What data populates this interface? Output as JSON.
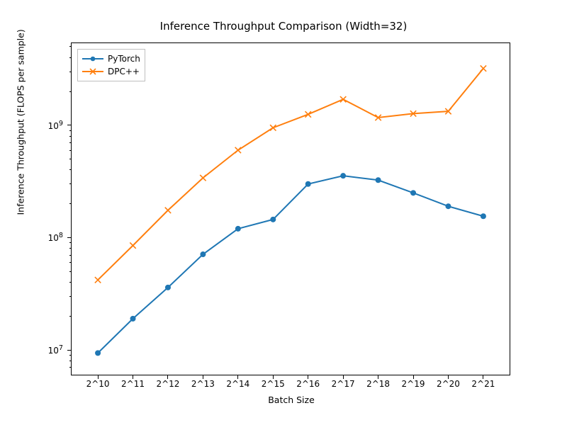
{
  "chart_data": {
    "type": "line",
    "title": "Inference Throughput Comparison (Width=32)",
    "xlabel": "Batch Size",
    "ylabel": "Inference Throughput (FLOPS per sample)",
    "x_categories": [
      "2^10",
      "2^11",
      "2^12",
      "2^13",
      "2^14",
      "2^15",
      "2^16",
      "2^17",
      "2^18",
      "2^19",
      "2^20",
      "2^21"
    ],
    "y_scale": "log",
    "y_ticks": [
      10000000.0,
      100000000.0,
      1000000000.0
    ],
    "y_tick_labels": [
      "10^7",
      "10^8",
      "10^9"
    ],
    "y_range_log10": [
      6.78,
      9.73
    ],
    "series": [
      {
        "name": "PyTorch",
        "color": "#1f77b4",
        "marker": "circle",
        "values": [
          9400000.0,
          19000000.0,
          36000000.0,
          71000000.0,
          120000000.0,
          145000000.0,
          300000000.0,
          355000000.0,
          325000000.0,
          250000000.0,
          190000000.0,
          155000000.0
        ]
      },
      {
        "name": "DPC++",
        "color": "#ff7f0e",
        "marker": "x",
        "values": [
          42000000.0,
          85000000.0,
          175000000.0,
          340000000.0,
          600000000.0,
          950000000.0,
          1250000000.0,
          1700000000.0,
          1170000000.0,
          1270000000.0,
          1330000000.0,
          3200000000.0
        ]
      }
    ],
    "legend_position": "upper left"
  }
}
